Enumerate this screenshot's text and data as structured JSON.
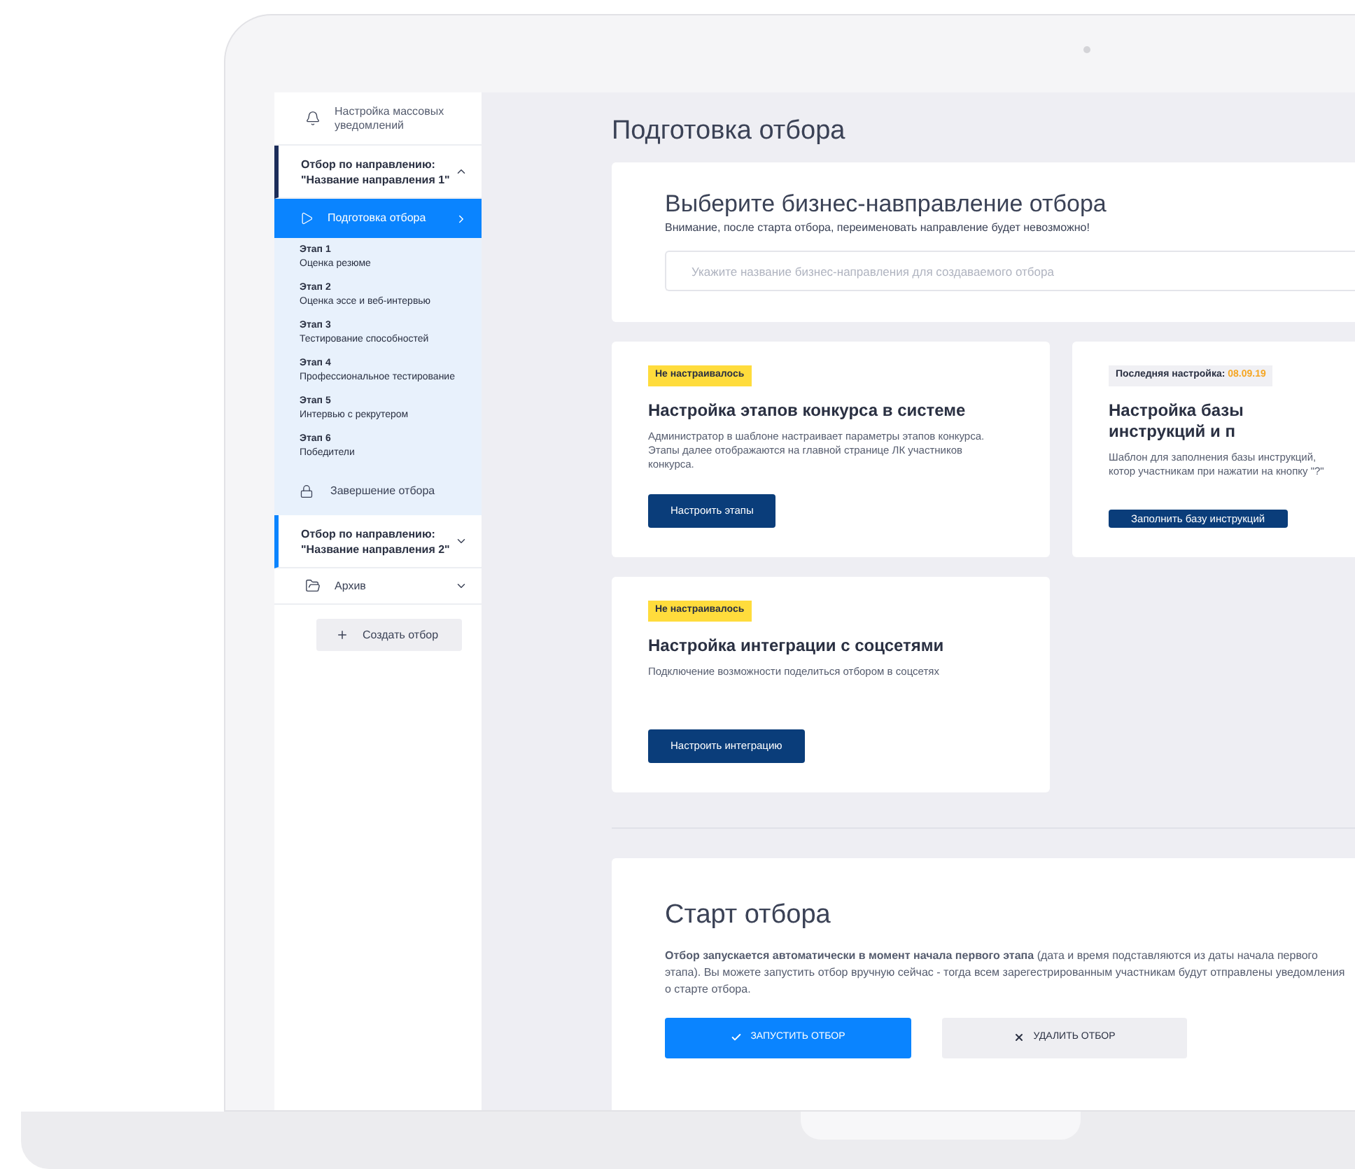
{
  "sidebar": {
    "top_link": {
      "label": "Настройка массовых уведомлений"
    },
    "groups": [
      {
        "label_1": "Отбор по направлению:",
        "label_2": "\"Название направления 1\"",
        "expanded": true,
        "items": [
          {
            "kind": "step",
            "label": "Подготовка отбора",
            "selected": true
          },
          {
            "kind": "stage",
            "title": "Этап 1",
            "subtitle": "Оценка резюме",
            "selected": false
          },
          {
            "kind": "stage",
            "title": "Этап 2",
            "subtitle": "Оценка эссе и веб-интервью",
            "selected": false
          },
          {
            "kind": "stage",
            "title": "Этап 3",
            "subtitle": "Тестирование способностей",
            "selected": false
          },
          {
            "kind": "stage",
            "title": "Этап 4",
            "subtitle": "Профессиональное тестирование",
            "selected": false
          },
          {
            "kind": "stage",
            "title": "Этап 5",
            "subtitle": "Интервью с рекрутером",
            "selected": false
          },
          {
            "kind": "stage",
            "title": "Этап 6",
            "subtitle": "Победители",
            "selected": false
          },
          {
            "kind": "locked",
            "label": "Завершение отбора",
            "selected": false
          }
        ]
      },
      {
        "label_1": "Отбор по направлению:",
        "label_2": "\"Название направления 2\"",
        "expanded": false
      }
    ],
    "archive": {
      "label": "Архив",
      "expanded": false
    },
    "create_button": {
      "label": "Создать отбор"
    }
  },
  "page_title": "Подготовка отбора",
  "direction_card": {
    "title": "Выберите бизнес-навправление отбора",
    "warning": "Внимание, после старта отбора, переименовать направление будет невозможно!",
    "input": {
      "placeholder": "Укажите название бизнес-направления для создаваемого отбора"
    }
  },
  "settings_cards": [
    {
      "badge": {
        "kind": "not_set",
        "text": "Не настраивалось"
      },
      "title": "Настройка этапов конкурса в системе",
      "description": "Администратор в шаблоне настраивает параметры этапов конкурса. Этапы далее отображаются на главной странице ЛК участников конкурса.",
      "button": "Настроить этапы"
    },
    {
      "badge": {
        "kind": "last_set",
        "text": "Последняя настройка:",
        "date": "08.09.19"
      },
      "title": "Настройка базы инструкций и п",
      "description": "Шаблон для заполнения базы инструкций, котор участникам при нажатии на кнопку \"?\"",
      "button": "Заполнить базу инструкций"
    },
    {
      "badge": {
        "kind": "not_set",
        "text": "Не настраивалось"
      },
      "title": "Настройка интеграции с соцсетями",
      "description": "Подключение возможности поделиться отбором в соцсетях",
      "button": "Настроить интеграцию"
    }
  ],
  "start": {
    "title": "Старт отбора",
    "description": "**Отбор запускается автоматически в момент начала первого этапа** (дата и время подставляются из даты начала первого этапа). Вы можете запустить отбор вручную сейчас - тогда всем зарегестрированным участникам будут отправлены уведомления о старте отбора.",
    "buttons": [
      {
        "kind": "primary",
        "label": "ЗАПУСТИТЬ ОТБОР"
      },
      {
        "kind": "secondary",
        "label": "УДАЛИТЬ ОТБОР"
      }
    ]
  }
}
